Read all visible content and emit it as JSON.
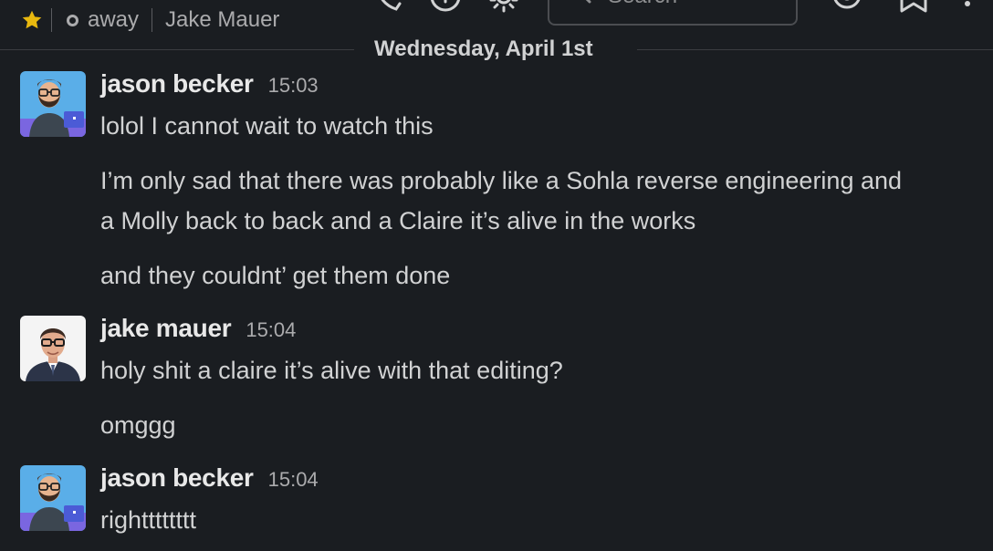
{
  "header": {
    "status": "away",
    "user_name": "Jake Mauer",
    "search_placeholder": "Search"
  },
  "date_divider": "Wednesday, April 1st",
  "messages": [
    {
      "sender": "jason becker",
      "time": "15:03",
      "lines": [
        "lolol I cannot wait to watch this",
        "I’m only sad that there was probably like a Sohla reverse engineering and",
        "a Molly back to back and a Claire it’s alive in the works",
        "and they couldnt’ get them done"
      ]
    },
    {
      "sender": "jake mauer",
      "time": "15:04",
      "lines": [
        "holy shit a claire it’s alive with that editing?",
        "omggg"
      ]
    },
    {
      "sender": "jason becker",
      "time": "15:04",
      "lines": [
        "rightttttttt"
      ]
    }
  ],
  "colors": {
    "background": "#1a1d21",
    "text": "#d1d2d3",
    "muted": "#ababad",
    "star": "#e8b80f"
  }
}
